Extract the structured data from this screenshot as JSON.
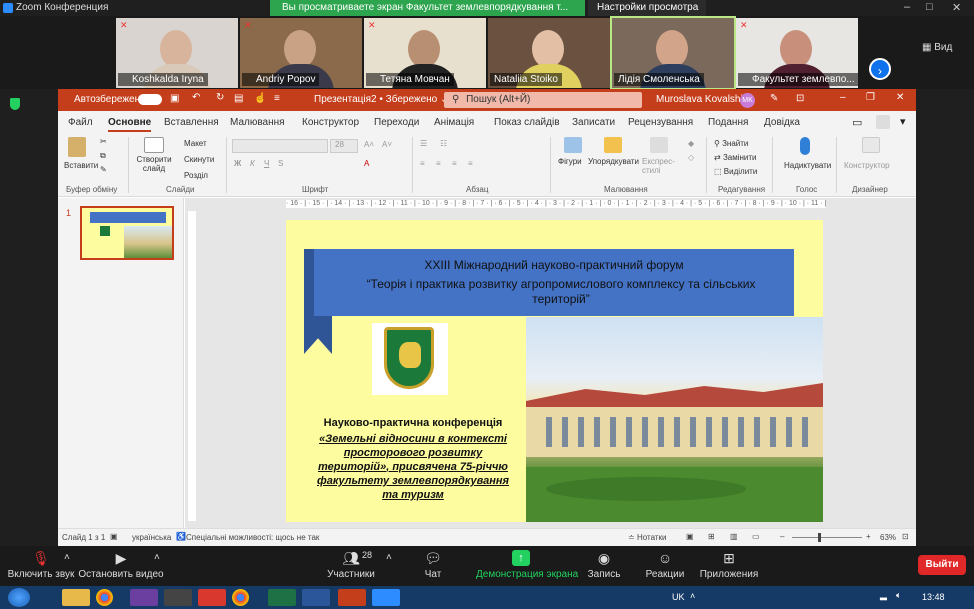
{
  "zoom": {
    "window_title": "Zoom Конференция",
    "share_banner": "Вы просматриваете экран Факультет землевпорядкування т...",
    "view_options": "Настройки просмотра",
    "view_label": "Вид",
    "participants_tiles": [
      {
        "name": "Koshkalda Iryna",
        "muted": true
      },
      {
        "name": "Andriy Popov",
        "muted": true
      },
      {
        "name": "Тетяна Мовчан",
        "muted": true
      },
      {
        "name": "Nataliia Stoiko",
        "muted": false
      },
      {
        "name": "Лідія Смоленська",
        "muted": false
      },
      {
        "name": "Факультет землевпо...",
        "muted": true
      }
    ],
    "toolbar": {
      "unmute": "Включить звук",
      "start_video": "Остановить видео",
      "participants": "Участники",
      "participants_count": "28",
      "chat": "Чат",
      "share_screen": "Демонстрация экрана",
      "record": "Запись",
      "reactions": "Реакции",
      "apps": "Приложения",
      "leave": "Выйти"
    }
  },
  "ppt": {
    "autosave": "Автозбереження",
    "doc_title": "Презентація2 • Збережено",
    "search_placeholder": "Пошук (Alt+Й)",
    "user_name": "Muroslava Kovalshin",
    "user_initials": "MK",
    "tabs": [
      "Файл",
      "Основне",
      "Вставлення",
      "Малювання",
      "Конструктор",
      "Переходи",
      "Анімація",
      "Показ слайдів",
      "Записати",
      "Рецензування",
      "Подання",
      "Довідка"
    ],
    "ribbon": {
      "paste": "Вставити",
      "clipboard_group": "Буфер обміну",
      "new_slide": "Створити слайд",
      "layout": "Макет",
      "reset": "Скинути",
      "section": "Розділ",
      "slides_group": "Слайди",
      "font_size": "28",
      "font_group": "Шрифт",
      "paragraph_group": "Абзац",
      "shapes": "Фігури",
      "arrange": "Упорядкувати",
      "quick_styles": "Експрес-стилі",
      "drawing_group": "Малювання",
      "find": "Знайти",
      "replace": "Замінити",
      "select": "Виділити",
      "editing_group": "Редагування",
      "dictate": "Надиктувати",
      "voice_group": "Голос",
      "designer": "Конструктор",
      "designer_group": "Дизайнер"
    },
    "slide_number": "1",
    "ruler_h": "· 16 · | · 15 · | · 14 · | · 13 · | · 12 · | · 11 · | · 10 · | · 9 · | · 8 · | · 7 · | · 6 · | · 5 · | · 4 · | · 3 · | · 2 · | · 1 · | · 0 · | · 1 · | · 2 · | · 3 · | · 4 · | · 5 · | · 6 · | · 7 · | · 8 · | · 9 · | · 10 · | · 11 · | · 12 · | · 13 · | · 14 · | · 15 · | · 16 ·",
    "slide": {
      "title_line1": "XXIII Міжнародний науково-практичний форум",
      "title_line2": "“Теорія і практика розвитку агропромислового комплексу та сільських територій”",
      "conf_heading": "Науково-практична конференція",
      "conf_theme": "«Земельні відносини в контексті просторового розвитку територій»",
      "conf_dedication": ", присвячена 75-річчю факультету землевпорядкування та туризм"
    },
    "status": {
      "slide_of": "Слайд 1 з 1",
      "language": "українська",
      "accessibility": "Спеціальні можливості: щось не так",
      "notes": "Нотатки",
      "zoom": "63%"
    }
  },
  "taskbar": {
    "lang": "UK",
    "time": "13:48"
  }
}
